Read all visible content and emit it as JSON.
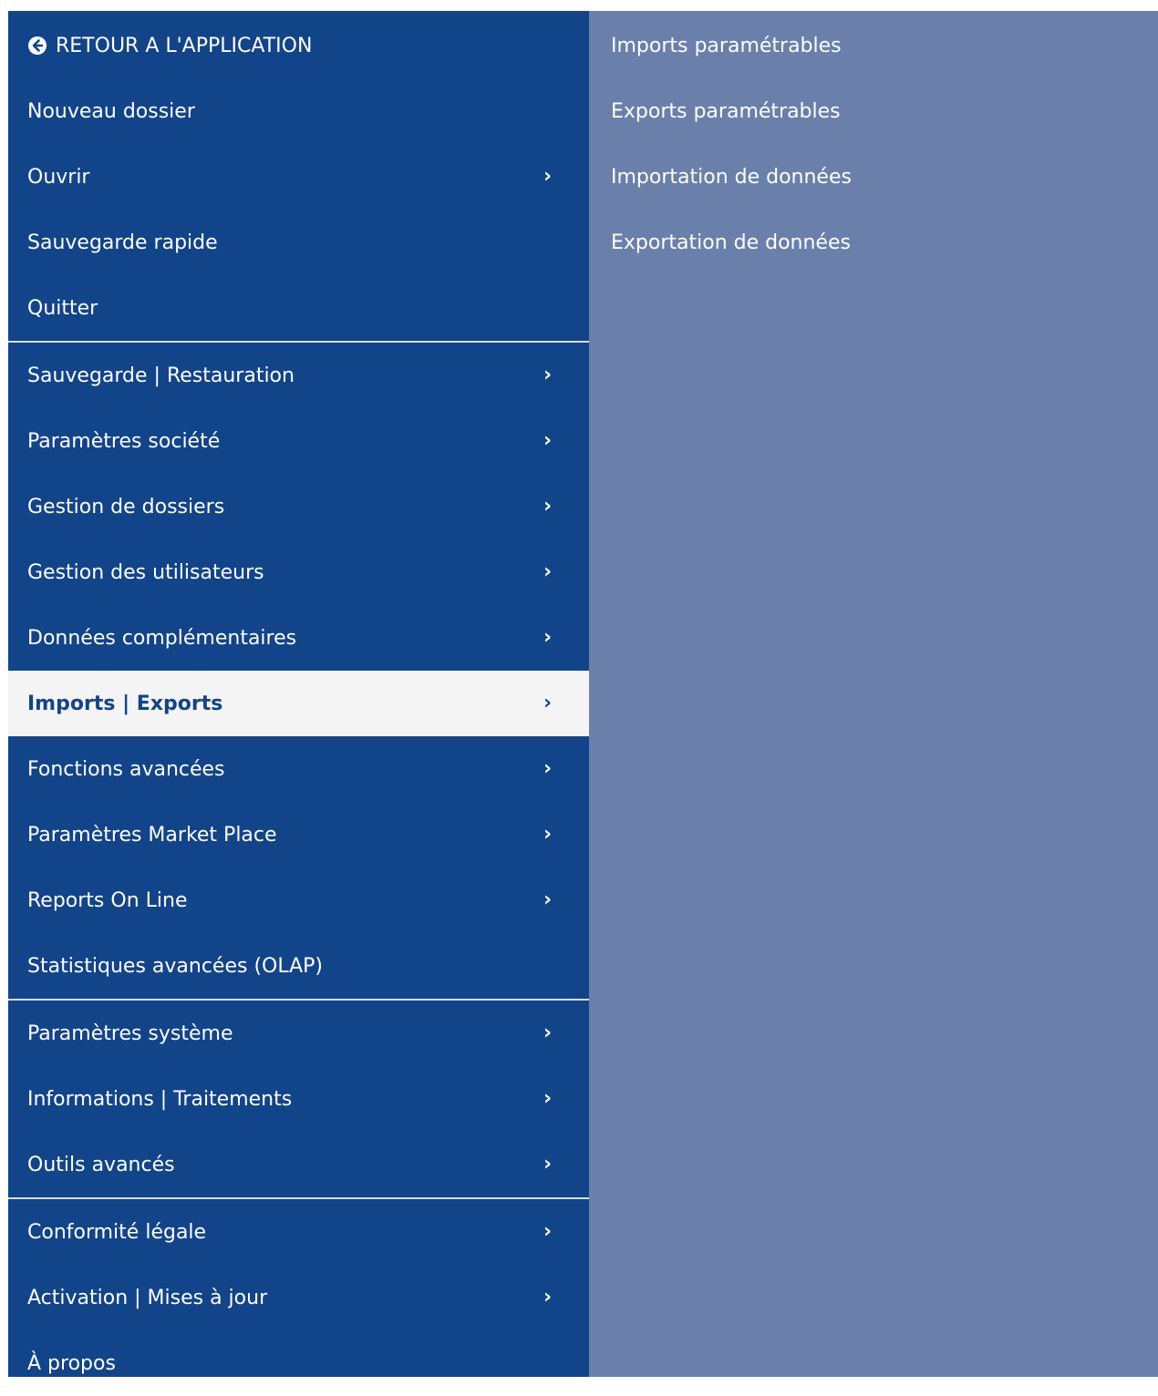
{
  "menu": {
    "back_label": "RETOUR A L'APPLICATION",
    "items": [
      {
        "label": "Nouveau dossier"
      },
      {
        "label": "Ouvrir",
        "chevron": "›"
      },
      {
        "label": "Sauvegarde rapide"
      },
      {
        "label": "Quitter"
      },
      {
        "label": "Sauvegarde | Restauration",
        "chevron": "›"
      },
      {
        "label": "Paramètres société",
        "chevron": "›"
      },
      {
        "label": "Gestion de dossiers",
        "chevron": "›"
      },
      {
        "label": "Gestion des utilisateurs",
        "chevron": "›"
      },
      {
        "label": "Données complémentaires",
        "chevron": "›"
      },
      {
        "label": "Imports | Exports",
        "chevron": "›",
        "active": true
      },
      {
        "label": "Fonctions avancées",
        "chevron": "›"
      },
      {
        "label": "Paramètres Market Place",
        "chevron": "›"
      },
      {
        "label": "Reports On Line",
        "chevron": "›"
      },
      {
        "label": "Statistiques avancées (OLAP)"
      },
      {
        "label": "Paramètres système",
        "chevron": "›"
      },
      {
        "label": "Informations | Traitements",
        "chevron": "›"
      },
      {
        "label": "Outils avancés",
        "chevron": "›"
      },
      {
        "label": "Conformité légale",
        "chevron": "›"
      },
      {
        "label": "Activation | Mises à jour",
        "chevron": "›"
      },
      {
        "label": "À propos"
      }
    ]
  },
  "submenu": {
    "items": [
      {
        "label": "Imports paramétrables"
      },
      {
        "label": "Exports paramétrables"
      },
      {
        "label": "Importation de données"
      },
      {
        "label": "Exportation de données"
      }
    ]
  },
  "colors": {
    "menu_bg": "#12448a",
    "submenu_bg": "#6a80ab",
    "active_bg": "#f4f4f4",
    "text": "#ffffff",
    "active_text": "#12448a"
  }
}
